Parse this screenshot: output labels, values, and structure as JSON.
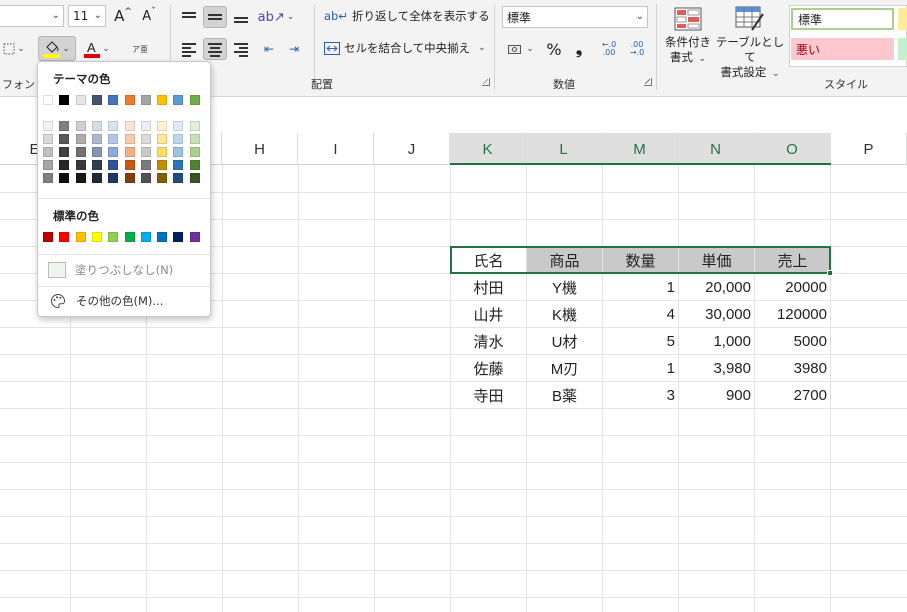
{
  "ribbon": {
    "font_size": "11",
    "font_group_label": "フォント",
    "alignment": {
      "wrap_text_label": "折り返して全体を表示する",
      "merge_center_label": "セルを結合して中央揃え",
      "group_label": "配置"
    },
    "number": {
      "format_value": "標準",
      "percent_symbol": "%",
      "comma_symbol": "❟",
      "decrease_decimal": "←.0 .00",
      "increase_decimal": ".00 →.0",
      "group_label": "数値"
    },
    "styles": {
      "conditional_format_line1": "条件付き",
      "conditional_format_line2": "書式",
      "format_as_table_line1": "テーブルとして",
      "format_as_table_line2": "書式設定",
      "normal_style": "標準",
      "bad_style": "悪い",
      "group_label": "スタイル"
    },
    "phonetic_label": "ア亜",
    "colors": {
      "fill_bar": "#ffff00",
      "font_bar": "#e00000",
      "selection_green": "#217346",
      "normal_border": "#a9d08e",
      "bad_fill": "#ffc7ce",
      "bad_text": "#9c0006"
    }
  },
  "color_menu": {
    "theme_title": "テーマの色",
    "standard_title": "標準の色",
    "no_fill_label": "塗りつぶしなし(N)",
    "more_colors_label": "その他の色(M)...",
    "theme_colors": [
      "#ffffff",
      "#000000",
      "#e7e6e6",
      "#44546a",
      "#4472c4",
      "#ed7d31",
      "#a5a5a5",
      "#ffc000",
      "#5b9bd5",
      "#70ad47"
    ],
    "theme_shades": [
      [
        "#f2f2f2",
        "#d9d9d9",
        "#bfbfbf",
        "#a6a6a6",
        "#808080"
      ],
      [
        "#7f7f7f",
        "#595959",
        "#404040",
        "#262626",
        "#0d0d0d"
      ],
      [
        "#d0cece",
        "#aeabab",
        "#757171",
        "#3a3838",
        "#171616"
      ],
      [
        "#d6dce4",
        "#adb9ca",
        "#8497b0",
        "#333f4f",
        "#222a35"
      ],
      [
        "#d9e1f2",
        "#b4c6e7",
        "#8ea9db",
        "#305496",
        "#203764"
      ],
      [
        "#fce4d6",
        "#f8cbad",
        "#f4b084",
        "#c65911",
        "#833c0c"
      ],
      [
        "#ededed",
        "#dbdbdb",
        "#c9c9c9",
        "#7b7b7b",
        "#525252"
      ],
      [
        "#fff2cc",
        "#ffe699",
        "#ffd966",
        "#bf8f00",
        "#806000"
      ],
      [
        "#ddebf7",
        "#bdd7ee",
        "#9bc2e6",
        "#2f75b5",
        "#1f4e78"
      ],
      [
        "#e2efda",
        "#c6e0b4",
        "#a9d08e",
        "#548235",
        "#375623"
      ]
    ],
    "standard_colors": [
      "#c00000",
      "#ff0000",
      "#ffc000",
      "#ffff00",
      "#92d050",
      "#00b050",
      "#00b0f0",
      "#0070c0",
      "#002060",
      "#7030a0"
    ]
  },
  "columns": [
    "E",
    "F",
    "G",
    "H",
    "I",
    "J",
    "K",
    "L",
    "M",
    "N",
    "O",
    "P"
  ],
  "table": {
    "headers": [
      "氏名",
      "商品",
      "数量",
      "単価",
      "売上"
    ],
    "rows": [
      [
        "村田",
        "Y機",
        "1",
        "20,000",
        "20000"
      ],
      [
        "山井",
        "K機",
        "4",
        "30,000",
        "120000"
      ],
      [
        "清水",
        "U材",
        "5",
        "1,000",
        "5000"
      ],
      [
        "佐藤",
        "M刃",
        "1",
        "3,980",
        "3980"
      ],
      [
        "寺田",
        "B薬",
        "3",
        "900",
        "2700"
      ]
    ]
  }
}
